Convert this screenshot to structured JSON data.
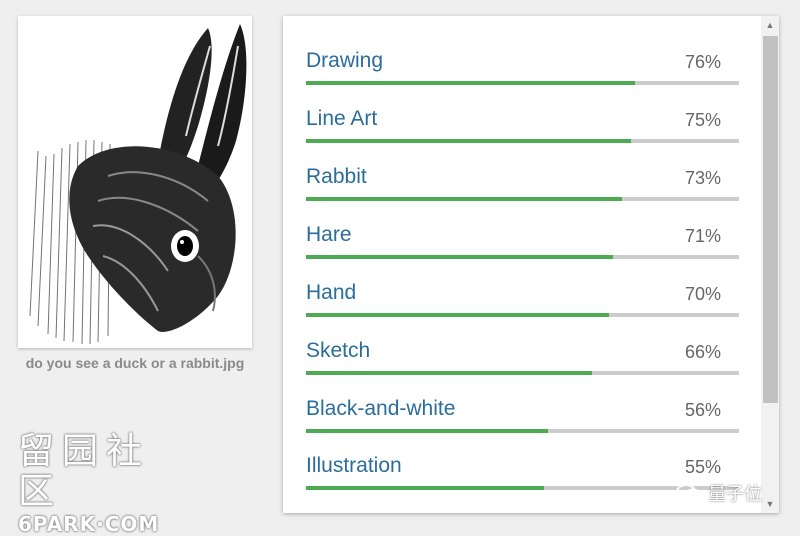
{
  "image": {
    "filename": "do you see a duck or a rabbit.jpg",
    "subject_icon": "rabbit-engraving"
  },
  "labels": [
    {
      "name": "Drawing",
      "score": "76%",
      "fraction": 0.76
    },
    {
      "name": "Line Art",
      "score": "75%",
      "fraction": 0.75
    },
    {
      "name": "Rabbit",
      "score": "73%",
      "fraction": 0.73
    },
    {
      "name": "Hare",
      "score": "71%",
      "fraction": 0.71
    },
    {
      "name": "Hand",
      "score": "70%",
      "fraction": 0.7
    },
    {
      "name": "Sketch",
      "score": "66%",
      "fraction": 0.66
    },
    {
      "name": "Black-and-white",
      "score": "56%",
      "fraction": 0.56
    },
    {
      "name": "Illustration",
      "score": "55%",
      "fraction": 0.55
    }
  ],
  "colors": {
    "label_text": "#2a6d9b",
    "bar_fill": "#4caa52",
    "bar_track": "#cccccc"
  },
  "watermarks": {
    "left_cn": "留园社区",
    "left_en": "6PARK·COM",
    "right_text": "量子位",
    "right_icon": "wechat-icon"
  }
}
